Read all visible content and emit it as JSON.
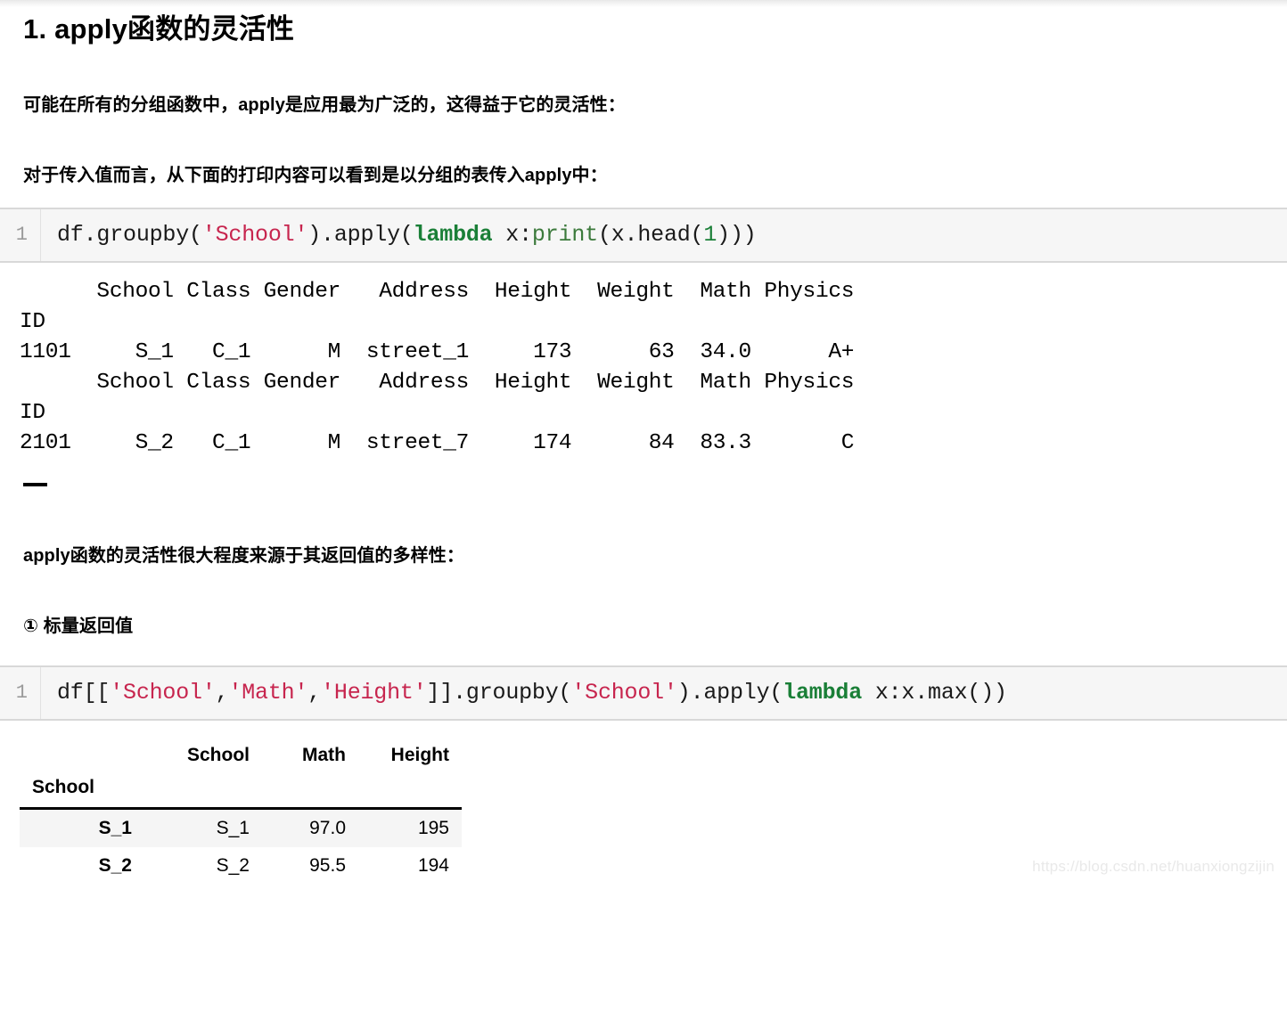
{
  "document": {
    "title": "1. apply函数的灵活性",
    "paragraphs": {
      "p1": "可能在所有的分组函数中，apply是应用最为广泛的，这得益于它的灵活性：",
      "p2": "对于传入值而言，从下面的打印内容可以看到是以分组的表传入apply中：",
      "p3": "apply函数的灵活性很大程度来源于其返回值的多样性：",
      "p4": "① 标量返回值"
    }
  },
  "code_cell_1": {
    "line_number": "1",
    "tokens": {
      "t1": "df.groupby(",
      "t2": "'School'",
      "t3": ").apply(",
      "t4": "lambda",
      "t5": " x:",
      "t6": "print",
      "t7": "(x.head(",
      "t8": "1",
      "t9": ")))"
    }
  },
  "stdout_1": {
    "text": "      School Class Gender   Address  Height  Weight  Math Physics\nID                                                              \n1101     S_1   C_1      M  street_1     173      63  34.0      A+\n      School Class Gender   Address  Height  Weight  Math Physics\nID                                                              \n2101     S_2   C_1      M  street_7     174      84  83.3       C"
  },
  "truncation_marker": {
    "glyph": "em-dash"
  },
  "code_cell_2": {
    "line_number": "1",
    "tokens": {
      "t1": "df[[",
      "t2": "'School'",
      "t3": ",",
      "t4": "'Math'",
      "t5": ",",
      "t6": "'Height'",
      "t7": "]].groupby(",
      "t8": "'School'",
      "t9": ").apply(",
      "t10": "lambda",
      "t11": " x:x.max())"
    }
  },
  "dataframe": {
    "columns": [
      "School",
      "Math",
      "Height"
    ],
    "index_name": "School",
    "index": [
      "S_1",
      "S_2"
    ],
    "rows": [
      {
        "index": "S_1",
        "School": "S_1",
        "Math": "97.0",
        "Height": "195"
      },
      {
        "index": "S_2",
        "School": "S_2",
        "Math": "95.5",
        "Height": "194"
      }
    ]
  },
  "watermark": {
    "text": "https://blog.csdn.net/huanxiongzijin"
  },
  "colors": {
    "string_token": "#c7254e",
    "keyword_token": "#1a7f37",
    "code_background": "#f6f6f6",
    "gutter_text": "#9a9a9a",
    "row_stripe": "#f5f5f5"
  }
}
